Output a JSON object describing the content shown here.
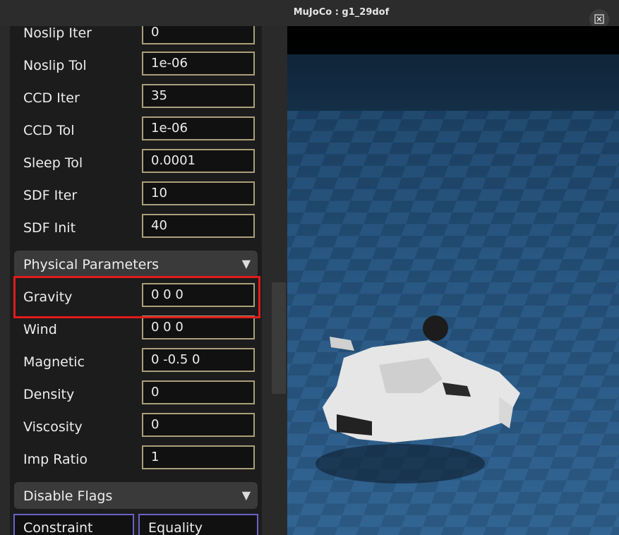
{
  "window": {
    "title": "MuJoCo : g1_29dof"
  },
  "settings_rows": [
    {
      "label": "Noslip Iter",
      "value": "0"
    },
    {
      "label": "Noslip Tol",
      "value": "1e-06"
    },
    {
      "label": "CCD Iter",
      "value": "35"
    },
    {
      "label": "CCD Tol",
      "value": "1e-06"
    },
    {
      "label": "Sleep Tol",
      "value": "0.0001"
    },
    {
      "label": "SDF Iter",
      "value": "10"
    },
    {
      "label": "SDF Init",
      "value": "40"
    }
  ],
  "physical_parameters": {
    "title": "Physical Parameters",
    "rows": [
      {
        "label": "Gravity",
        "value": "0  0  0"
      },
      {
        "label": "Wind",
        "value": "0  0  0"
      },
      {
        "label": "Magnetic",
        "value": "0  -0.5  0"
      },
      {
        "label": "Density",
        "value": "0"
      },
      {
        "label": "Viscosity",
        "value": "0"
      },
      {
        "label": "Imp Ratio",
        "value": "1"
      }
    ]
  },
  "disable_flags": {
    "title": "Disable Flags",
    "buttons": [
      "Constraint",
      "Equality"
    ]
  },
  "icons": {
    "section_toggle": "triangle-down-icon",
    "close": "close-icon"
  },
  "colors": {
    "highlight": "#e01b1b",
    "field_border": "#a99f79",
    "flag_border": "#6a62c7"
  }
}
